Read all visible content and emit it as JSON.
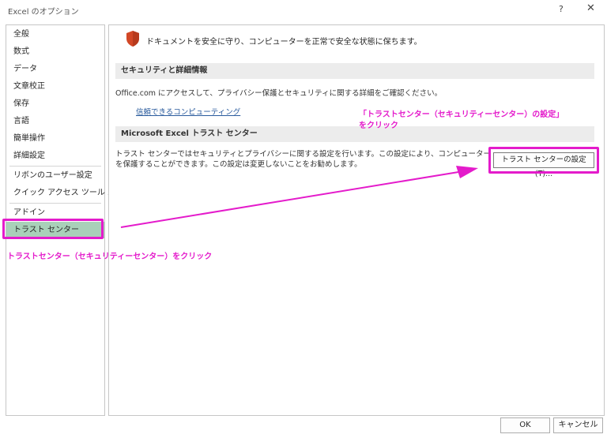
{
  "window": {
    "title": "Excel のオプション",
    "help": "?",
    "close": "✕"
  },
  "sidebar": {
    "items": [
      {
        "label": "全般"
      },
      {
        "label": "数式"
      },
      {
        "label": "データ"
      },
      {
        "label": "文章校正"
      },
      {
        "label": "保存"
      },
      {
        "label": "言語"
      },
      {
        "label": "簡単操作"
      },
      {
        "label": "詳細設定"
      },
      {
        "label": "リボンのユーザー設定"
      },
      {
        "label": "クイック アクセス ツール バー"
      },
      {
        "label": "アドイン"
      },
      {
        "label": "トラスト センター"
      }
    ],
    "selected": "トラスト センター"
  },
  "main": {
    "header": "ドキュメントを安全に守り、コンピューターを正常で安全な状態に保ちます。",
    "section1": {
      "title": "セキュリティと詳細情報",
      "description": "Office.com にアクセスして、プライバシー保護とセキュリティに関する詳細をご確認ください。",
      "link": "信頼できるコンピューティング"
    },
    "section2": {
      "title": "Microsoft Excel トラスト センター",
      "description": "トラスト センターではセキュリティとプライバシーに関する設定を行います。この設定により、コンピューターを保護することができます。この設定は変更しないことをお勧めします。",
      "button": "トラスト センターの設定(T)..."
    }
  },
  "annotations": {
    "button_note_line1": "「トラストセンター（セキュリティーセンター）の設定」",
    "button_note_line2": "をクリック",
    "sidebar_note": "トラストセンター（セキュリティーセンター）をクリック",
    "color": "#e41bcb"
  },
  "footer": {
    "ok": "OK",
    "cancel": "キャンセル"
  },
  "colors": {
    "selected_bg": "#a9d0b9",
    "section_bg": "#ececec",
    "link": "#2a5b9d",
    "shield": "#d24726"
  }
}
